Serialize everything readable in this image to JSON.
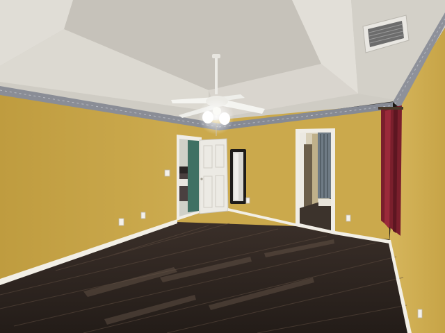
{
  "scene": {
    "subject": "empty-bedroom-interior",
    "colors": {
      "wall": "#c9a84a",
      "wall_shadow": "#b3923c",
      "ceiling": "#d9d6cf",
      "ceiling_shadow": "#c9c5bd",
      "floor_dark": "#2e2520",
      "floor_mid": "#4a3c33",
      "baseboard": "#f2efe6",
      "door": "#eceae4",
      "curtain": "#7a1f2c",
      "border_trim": "#8a8d96",
      "fan": "#f4f4f0"
    },
    "objects": [
      "tray-ceiling",
      "ceiling-fan-with-light",
      "hvac-vent",
      "wallpaper-border",
      "open-panel-door",
      "wall-mirror",
      "open-doorway",
      "red-curtain",
      "hardwood-floor",
      "baseboards",
      "electrical-outlets"
    ]
  }
}
